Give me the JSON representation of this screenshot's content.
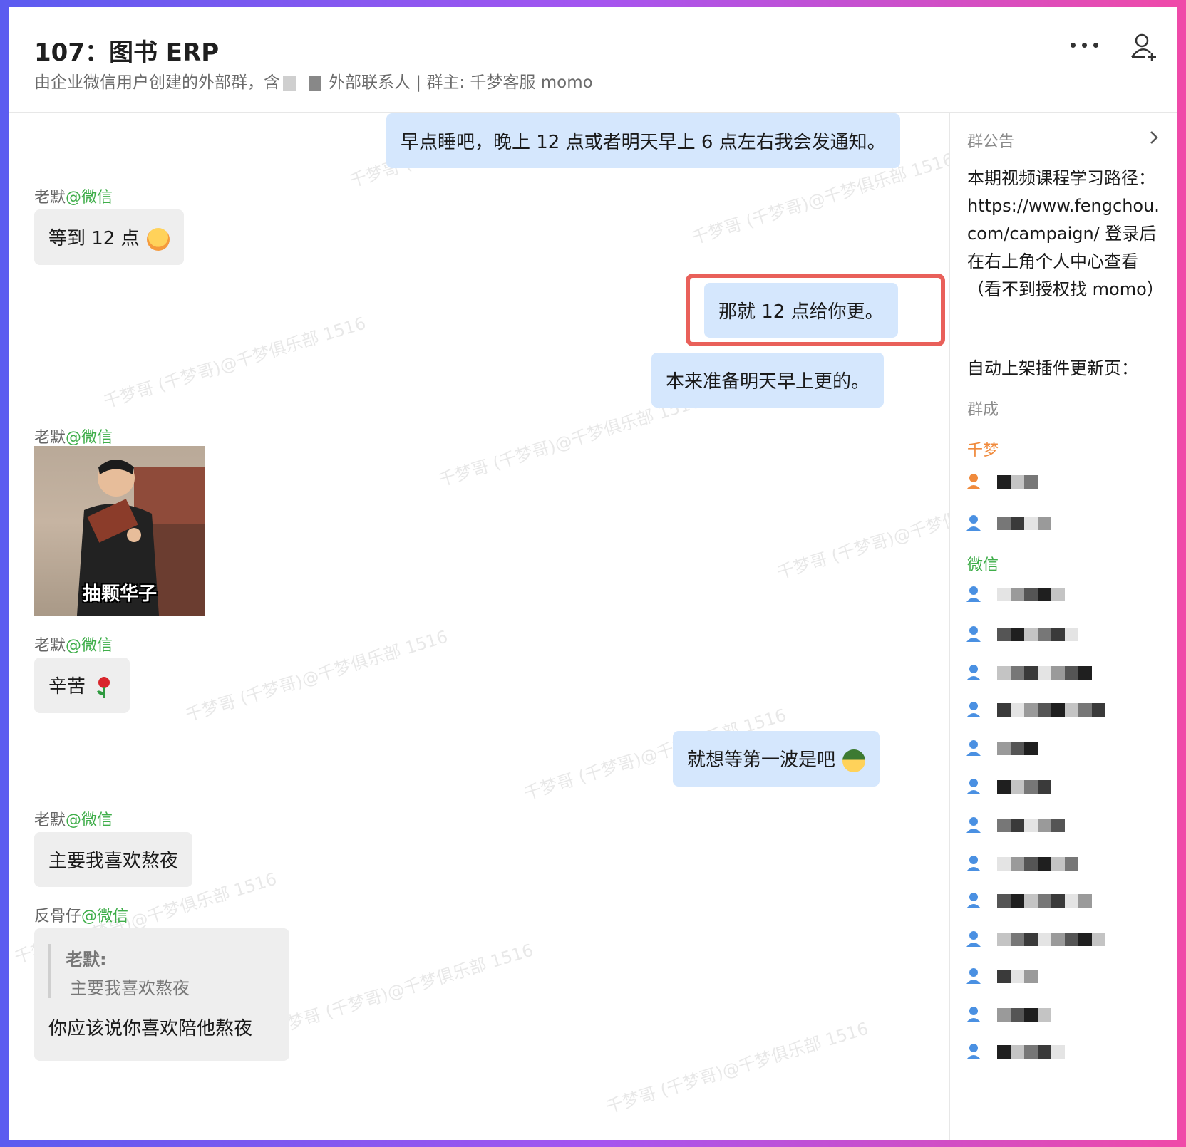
{
  "header": {
    "title": "107：图书 ERP",
    "subtitle_prefix": "由企业微信用户创建的外部群，含",
    "subtitle_suffix": "外部联系人 | 群主: 千梦客服 momo"
  },
  "watermark_text": "千梦哥 (千梦哥)@千梦俱乐部 1516",
  "messages": [
    {
      "side": "right",
      "text": "早点睡吧，晚上 12 点或者明天早上 6 点左右我会发通知。"
    },
    {
      "side": "left",
      "sender": "老默",
      "source": "@微信",
      "text": "等到 12 点",
      "emoji": "hot-face-emoji"
    },
    {
      "side": "right",
      "text": "那就 12 点给你更。",
      "highlighted": true
    },
    {
      "side": "right",
      "text": "本来准备明天早上更的。"
    },
    {
      "side": "left",
      "sender": "老默",
      "source": "@微信",
      "sticker_caption": "抽颗华子"
    },
    {
      "side": "left",
      "sender": "老默",
      "source": "@微信",
      "text": "辛苦",
      "emoji": "rose-emoji"
    },
    {
      "side": "right",
      "text": "就想等第一波是吧",
      "emoji": "cool-face-emoji"
    },
    {
      "side": "left",
      "sender": "老默",
      "source": "@微信",
      "text": "主要我喜欢熬夜"
    },
    {
      "side": "left",
      "sender": "反骨仔",
      "source": "@微信",
      "quote_author": "老默:",
      "quote_text": "主要我喜欢熬夜",
      "text": "你应该说你喜欢陪他熬夜"
    }
  ],
  "side": {
    "announcement_label": "群公告",
    "announcement_text": "本期视频课程学习路径：https://www.fengchou.com/campaign/ 登录后在右上角个人中心查看（看不到授权找 momo）",
    "announcement_text_2": "自动上架插件更新页：",
    "members_label": "群成",
    "group_qianmeng": "千梦",
    "group_weixin": "微信"
  },
  "colors": {
    "accent_green": "#3fae4a",
    "bubble_right": "#d5e7fd",
    "bubble_left": "#eeeeee",
    "highlight": "#e9605a",
    "member_icon": "#4a90e2",
    "owner_icon": "#f08a3c"
  },
  "icons": [
    "more-icon",
    "add-member-icon",
    "chevron-right-icon",
    "member-icon"
  ]
}
